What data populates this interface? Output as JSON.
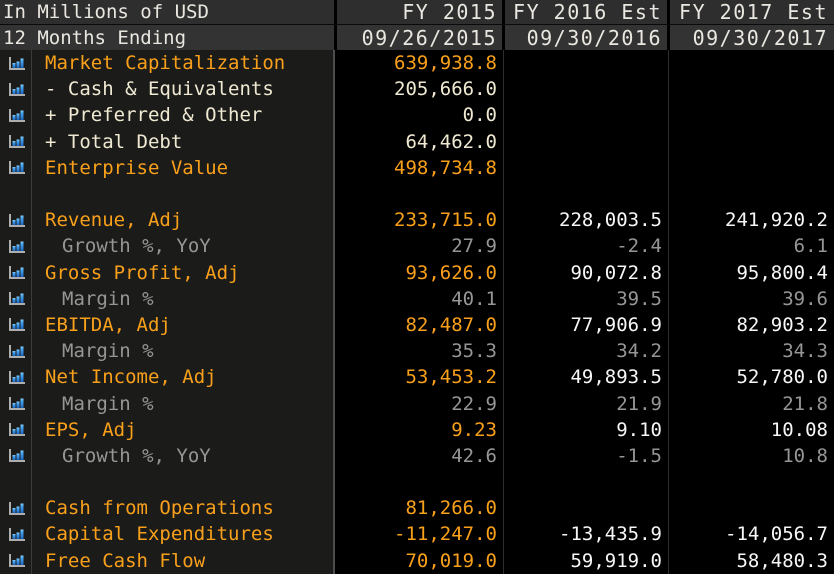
{
  "meta": {
    "units_label": "In Millions of USD",
    "period_label": "12 Months Ending"
  },
  "columns": [
    {
      "label": "FY 2015",
      "date": "09/26/2015"
    },
    {
      "label": "FY 2016 Est",
      "date": "09/30/2016"
    },
    {
      "label": "FY 2017 Est",
      "date": "09/30/2017"
    }
  ],
  "rows": [
    {
      "label": "Market Capitalization",
      "type": "primary",
      "values": [
        "639,938.8",
        "",
        ""
      ]
    },
    {
      "label": "- Cash & Equivalents",
      "type": "secondary",
      "values": [
        "205,666.0",
        "",
        ""
      ]
    },
    {
      "label": "+ Preferred & Other",
      "type": "secondary",
      "values": [
        "0.0",
        "",
        ""
      ]
    },
    {
      "label": "+ Total Debt",
      "type": "secondary",
      "values": [
        "64,462.0",
        "",
        ""
      ]
    },
    {
      "label": "Enterprise Value",
      "type": "primary",
      "values": [
        "498,734.8",
        "",
        ""
      ]
    },
    {
      "label": "",
      "type": "blank",
      "values": [
        "",
        "",
        ""
      ]
    },
    {
      "label": "Revenue, Adj",
      "type": "primary",
      "values": [
        "233,715.0",
        "228,003.5",
        "241,920.2"
      ]
    },
    {
      "label": "Growth %, YoY",
      "type": "sub",
      "values": [
        "27.9",
        "-2.4",
        "6.1"
      ]
    },
    {
      "label": "Gross Profit, Adj",
      "type": "primary",
      "values": [
        "93,626.0",
        "90,072.8",
        "95,800.4"
      ]
    },
    {
      "label": "Margin %",
      "type": "sub",
      "values": [
        "40.1",
        "39.5",
        "39.6"
      ]
    },
    {
      "label": "EBITDA, Adj",
      "type": "primary",
      "values": [
        "82,487.0",
        "77,906.9",
        "82,903.2"
      ]
    },
    {
      "label": "Margin %",
      "type": "sub",
      "values": [
        "35.3",
        "34.2",
        "34.3"
      ]
    },
    {
      "label": "Net Income, Adj",
      "type": "primary",
      "values": [
        "53,453.2",
        "49,893.5",
        "52,780.0"
      ]
    },
    {
      "label": "Margin %",
      "type": "sub",
      "values": [
        "22.9",
        "21.9",
        "21.8"
      ]
    },
    {
      "label": "EPS, Adj",
      "type": "primary",
      "values": [
        "9.23",
        "9.10",
        "10.08"
      ]
    },
    {
      "label": "Growth %, YoY",
      "type": "sub",
      "values": [
        "42.6",
        "-1.5",
        "10.8"
      ]
    },
    {
      "label": "",
      "type": "blank",
      "values": [
        "",
        "",
        ""
      ]
    },
    {
      "label": "Cash from Operations",
      "type": "primary",
      "values": [
        "81,266.0",
        "",
        ""
      ]
    },
    {
      "label": "Capital Expenditures",
      "type": "primary",
      "values": [
        "-11,247.0",
        "-13,435.9",
        "-14,056.7"
      ]
    },
    {
      "label": "Free Cash Flow",
      "type": "primary",
      "values": [
        "70,019.0",
        "59,919.0",
        "58,480.3"
      ]
    }
  ],
  "icons": {
    "row_icon": "bar-chart-icon"
  },
  "colors": {
    "amber": "#f9a01b",
    "cream": "#f0e9d2",
    "gray": "#969696",
    "estimate_white": "#f7f7f7",
    "header_bg": "#2e2e2e",
    "label_panel_bg": "#1b1b1a",
    "value_panel_bg": "#000000",
    "icon_blue": "#2f93e8"
  }
}
